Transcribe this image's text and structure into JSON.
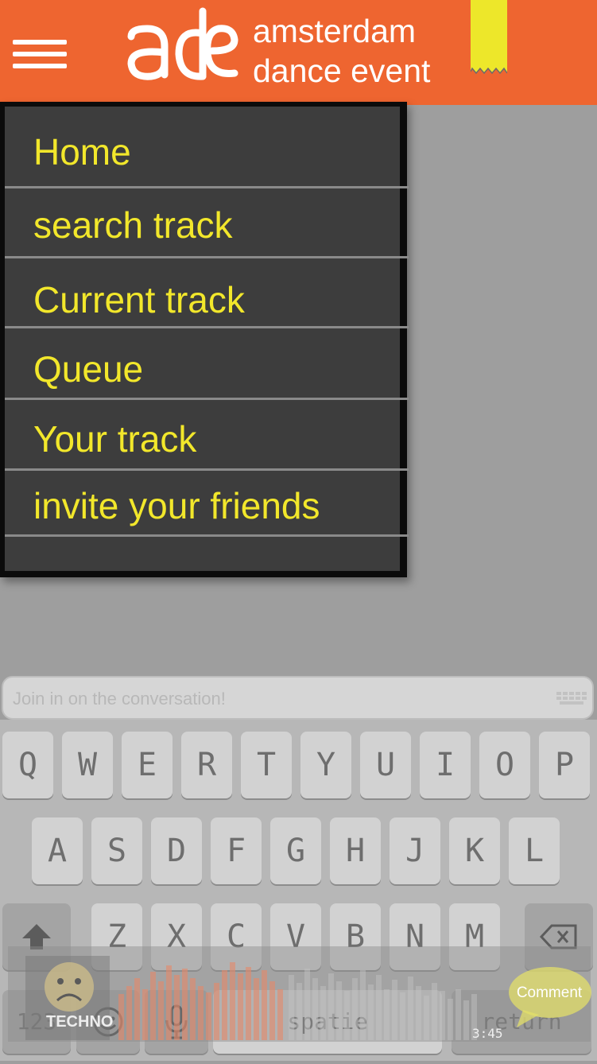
{
  "header": {
    "logo_text_line1": "amsterdam",
    "logo_text_line2": "dance event",
    "brand_color": "#ee6530",
    "bookmark_color": "#ede72a"
  },
  "menu": {
    "items": [
      {
        "label": "Home"
      },
      {
        "label": "search track"
      },
      {
        "label": "Current track"
      },
      {
        "label": "Queue"
      },
      {
        "label": "Your track"
      },
      {
        "label": "invite your friends"
      }
    ],
    "text_color": "#f2e72b",
    "background_color": "#3d3d3d"
  },
  "comment_input": {
    "placeholder": "Join in on the conversation!"
  },
  "keyboard": {
    "row1": [
      "Q",
      "W",
      "E",
      "R",
      "T",
      "Y",
      "U",
      "I",
      "O",
      "P"
    ],
    "row2": [
      "A",
      "S",
      "D",
      "F",
      "G",
      "H",
      "J",
      "K",
      "L"
    ],
    "row3": [
      "Z",
      "X",
      "C",
      "V",
      "B",
      "N",
      "M"
    ],
    "shift_icon": "shift-arrow-icon",
    "backspace_icon": "backspace-icon",
    "numbers_label": "123",
    "emoji_icon": "emoji-icon",
    "mic_icon": "microphone-icon",
    "space_label": "spatie",
    "return_label": "return"
  },
  "player": {
    "genre_label": "TECHNO",
    "time": "3:45",
    "comment_label": "Comment",
    "mood_icon": "sad-face-icon"
  }
}
